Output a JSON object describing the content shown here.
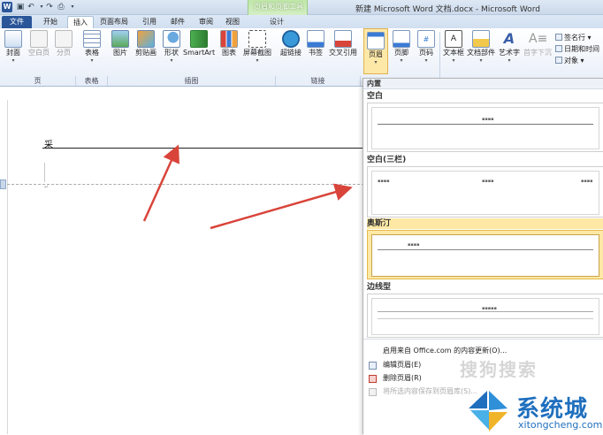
{
  "window": {
    "title": "新建 Microsoft Word 文档.docx - Microsoft Word",
    "app_icon": "W",
    "context_group": "页眉和页脚工具"
  },
  "quick_access": {
    "save": "save-icon",
    "undo": "undo-icon",
    "redo": "redo-icon",
    "print": "print-icon",
    "customize": "▾"
  },
  "tabs": {
    "file": "文件",
    "home": "开始",
    "insert": "插入",
    "layout": "页面布局",
    "references": "引用",
    "mailings": "邮件",
    "review": "审阅",
    "view": "视图",
    "design": "设计"
  },
  "ribbon": {
    "cover": "封面",
    "blank_page": "空白页",
    "page_break": "分页",
    "table": "表格",
    "picture": "图片",
    "clipart": "剪贴画",
    "shapes": "形状",
    "smartart": "SmartArt",
    "chart": "图表",
    "screenshot": "屏幕截图",
    "hyperlink": "超链接",
    "bookmark": "书签",
    "crossref": "交叉引用",
    "header": "页眉",
    "footer": "页脚",
    "pagenum": "页码",
    "textbox": "文本框",
    "quickparts": "文档部件",
    "wordart": "艺术字",
    "dropcap": "首字下沉",
    "signature": "签名行",
    "datetime": "日期和时间",
    "object": "对象",
    "groups": {
      "pages": "页",
      "tables": "表格",
      "illustrations": "插图",
      "links": "链接"
    }
  },
  "document": {
    "header_text": "采"
  },
  "dropdown": {
    "heading": "内置",
    "items": [
      {
        "label": "空白"
      },
      {
        "label": "空白(三栏)"
      },
      {
        "label": "奥斯汀"
      },
      {
        "label": "边线型"
      }
    ],
    "menu": {
      "more_online": "启用来自 Office.com 的内容更新(O)...",
      "edit_header": "编辑页眉(E)",
      "remove_header": "删除页眉(R)",
      "save_selection": "将所选内容保存到页眉库(S)..."
    }
  },
  "watermark": "搜狗搜索",
  "brand": {
    "name": "系统城",
    "url": "xitongcheng.com"
  },
  "colors": {
    "file_tab": "#2a5699",
    "context_green": "#bfe6a9",
    "selected": "#fde9a5",
    "brand": "#1f6fbe",
    "arrow": "#d9443a"
  }
}
